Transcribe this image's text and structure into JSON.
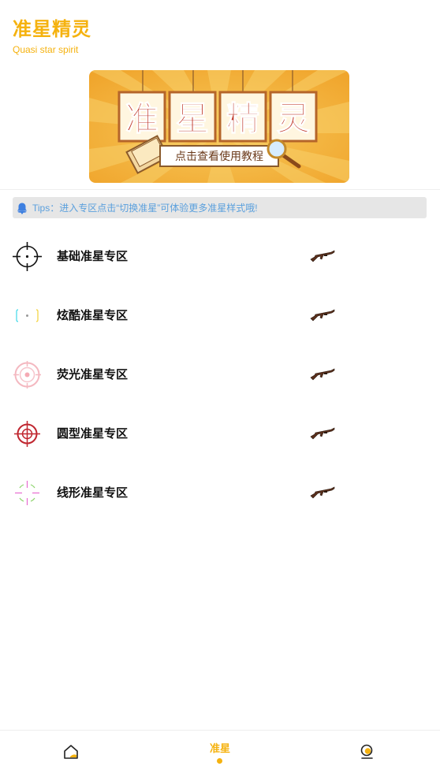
{
  "header": {
    "title": "准星精灵",
    "subtitle": "Quasi star spirit"
  },
  "banner": {
    "title_chars": [
      "准",
      "星",
      "精",
      "灵"
    ],
    "caption": "点击查看使用教程"
  },
  "tips": {
    "text": "Tips：进入专区点击“切换准星”可体验更多准星样式哦!"
  },
  "zones": [
    {
      "label": "基础准星专区",
      "icon": "crosshair-basic-icon"
    },
    {
      "label": "炫酷准星专区",
      "icon": "crosshair-cool-icon"
    },
    {
      "label": "荧光准星专区",
      "icon": "crosshair-fluorescent-icon"
    },
    {
      "label": "圆型准星专区",
      "icon": "crosshair-round-icon"
    },
    {
      "label": "线形准星专区",
      "icon": "crosshair-line-icon"
    }
  ],
  "bottom_nav": {
    "active_label": "准星",
    "items": [
      "home-icon",
      "准星",
      "profile-icon"
    ]
  },
  "colors": {
    "accent": "#f5b20f",
    "tips_text": "#5ba0dd",
    "tips_bg": "#e6e6e6"
  }
}
